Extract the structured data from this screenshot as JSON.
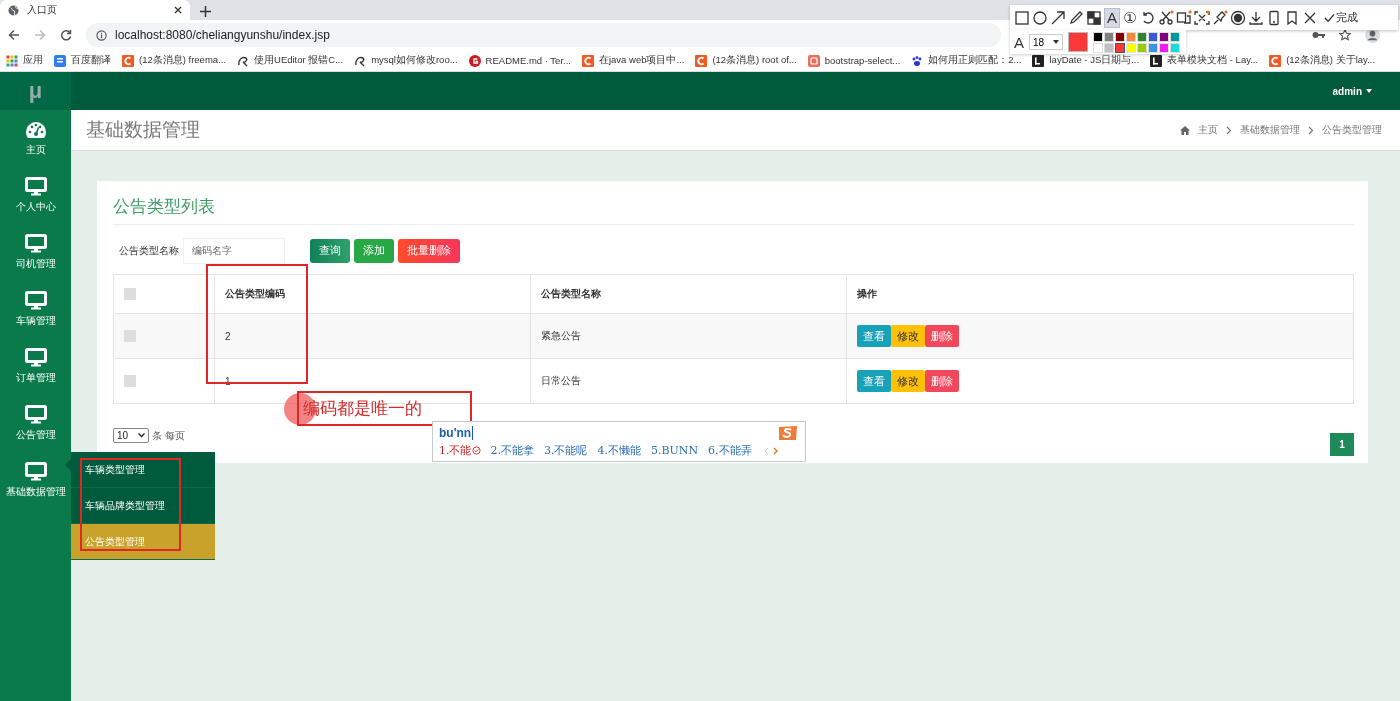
{
  "browser": {
    "tab": {
      "title": "入口页"
    },
    "url": "localhost:8080/cheliangyunshu/index.jsp",
    "bookmarks": [
      {
        "label": "应用",
        "kind": "apps"
      },
      {
        "label": "百度翻译",
        "kind": "translate"
      },
      {
        "label": "(12条消息) freema...",
        "kind": "csdn"
      },
      {
        "label": "使用UEditor 报错C...",
        "kind": "swirl"
      },
      {
        "label": "mysql如何修改roo...",
        "kind": "swirl"
      },
      {
        "label": "README.md · Ter...",
        "kind": "gitee"
      },
      {
        "label": "在java web项目中...",
        "kind": "csdn"
      },
      {
        "label": "(12条消息) root of...",
        "kind": "csdn"
      },
      {
        "label": "bootstrap-select...",
        "kind": "jianshu"
      },
      {
        "label": "如何用正则匹配：2...",
        "kind": "paw"
      },
      {
        "label": "layDate - JS日期与...",
        "kind": "layui"
      },
      {
        "label": "表单模块文档 - Lay...",
        "kind": "layui"
      },
      {
        "label": "(12条消息) 关于lay...",
        "kind": "csdn"
      }
    ]
  },
  "annotation_toolbar": {
    "tools": [
      {
        "kind": "rectangle",
        "selected": false
      },
      {
        "kind": "ellipse",
        "selected": false
      },
      {
        "kind": "arrow",
        "selected": false
      },
      {
        "kind": "pen",
        "selected": false
      },
      {
        "kind": "mosaic",
        "selected": false
      },
      {
        "kind": "text",
        "glyph": "A",
        "selected": true
      },
      {
        "kind": "number",
        "glyph": "①",
        "selected": false
      },
      {
        "kind": "undo",
        "selected": false
      },
      {
        "kind": "scissors",
        "selected": false
      },
      {
        "kind": "translate",
        "selected": false
      },
      {
        "kind": "ocr",
        "selected": false
      },
      {
        "kind": "pin",
        "selected": false
      },
      {
        "kind": "record",
        "selected": false
      },
      {
        "kind": "download",
        "selected": false
      },
      {
        "kind": "phone",
        "selected": false
      },
      {
        "kind": "bookmark",
        "selected": false
      },
      {
        "kind": "close",
        "selected": false
      }
    ],
    "done": "完成",
    "font_glyph": "A",
    "font_size": "18",
    "swatches": [
      {
        "color": "#000000",
        "selected": false
      },
      {
        "color": "#808080",
        "selected": false
      },
      {
        "color": "#800000",
        "selected": false
      },
      {
        "color": "#f7883a",
        "selected": false
      },
      {
        "color": "#308430",
        "selected": false
      },
      {
        "color": "#385ad3",
        "selected": false
      },
      {
        "color": "#800080",
        "selected": false
      },
      {
        "color": "#009999",
        "selected": false
      },
      {
        "color": "#ffffff",
        "selected": false
      },
      {
        "color": "#c0c0c0",
        "selected": false
      },
      {
        "color": "#fb3838",
        "selected": true
      },
      {
        "color": "#ffff00",
        "selected": false
      },
      {
        "color": "#99cc00",
        "selected": false
      },
      {
        "color": "#3894e4",
        "selected": false
      },
      {
        "color": "#f31bf3",
        "selected": false
      },
      {
        "color": "#16dcdc",
        "selected": false
      }
    ]
  },
  "sidebar": {
    "logo": "μ",
    "items": [
      {
        "label": "主页",
        "kind": "dashboard"
      },
      {
        "label": "个人中心",
        "kind": "monitor"
      },
      {
        "label": "司机管理",
        "kind": "monitor"
      },
      {
        "label": "车辆管理",
        "kind": "monitor"
      },
      {
        "label": "订单管理",
        "kind": "monitor"
      },
      {
        "label": "公告管理",
        "kind": "monitor"
      },
      {
        "label": "基础数据管理",
        "kind": "monitor",
        "submenu": [
          {
            "label": "车辆类型管理",
            "selected": false
          },
          {
            "label": "车辆品牌类型管理",
            "selected": false
          },
          {
            "label": "公告类型管理",
            "selected": true
          }
        ]
      }
    ]
  },
  "header": {
    "user": "admin"
  },
  "page": {
    "title": "基础数据管理",
    "breadcrumb": [
      "主页",
      "基础数据管理",
      "公告类型管理"
    ]
  },
  "card": {
    "title": "公告类型列表",
    "search": {
      "label": "公告类型名称",
      "placeholder": "编码名字"
    },
    "buttons": [
      {
        "label": "查询",
        "kind": "query"
      },
      {
        "label": "添加",
        "kind": "add"
      },
      {
        "label": "批量删除",
        "kind": "delete"
      }
    ],
    "table": {
      "select_all": {
        "checked": false
      },
      "columns": [
        "公告类型编码",
        "公告类型名称",
        "操作"
      ],
      "rows": [
        {
          "checked": false,
          "code": "2",
          "name": "紧急公告",
          "actions": [
            {
              "label": "查看",
              "kind": "view"
            },
            {
              "label": "修改",
              "kind": "edit"
            },
            {
              "label": "删除",
              "kind": "delete"
            }
          ]
        },
        {
          "checked": false,
          "code": "1",
          "name": "日常公告",
          "actions": [
            {
              "label": "查看",
              "kind": "view"
            },
            {
              "label": "修改",
              "kind": "edit"
            },
            {
              "label": "删除",
              "kind": "delete"
            }
          ]
        }
      ]
    },
    "page_size": "10",
    "page_size_label": "条 每页",
    "pages": [
      {
        "label": "1",
        "selected": true
      }
    ]
  },
  "annotations": {
    "note": "编码都是唯一的",
    "ime": {
      "input": "bu'nn",
      "candidates": [
        "1.不能",
        "2.不能拿",
        "3.不能呢",
        "4.不懒能",
        "5.BUNN",
        "6.不能弄"
      ]
    }
  }
}
